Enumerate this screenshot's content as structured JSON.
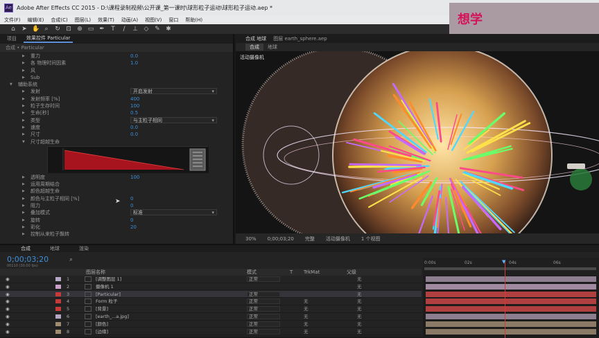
{
  "window": {
    "logo": "Ae",
    "title": "Adobe After Effects CC 2015 - D:\\课程录制视频\\公开课_第一课时\\球形粒子运动\\球形粒子运动.aep *"
  },
  "menu": [
    "文件(F)",
    "编辑(E)",
    "合成(C)",
    "图层(L)",
    "效果(T)",
    "动画(A)",
    "视图(V)",
    "窗口",
    "帮助(H)"
  ],
  "watermark": {
    "text": "想学"
  },
  "effects_panel": {
    "tabs": [
      "项目",
      "效果控件 Particular"
    ],
    "subheader": "合成 • Particular",
    "rows": [
      {
        "indent": 2,
        "label": "重力",
        "value": "0.0"
      },
      {
        "indent": 2,
        "label": "各 物理时间因素",
        "value": "1.0"
      },
      {
        "indent": 2,
        "label": "风",
        "value": ""
      },
      {
        "indent": 2,
        "label": "Sub",
        "value": ""
      },
      {
        "indent": 1,
        "label": "辅助系统",
        "value": "",
        "open": true
      },
      {
        "indent": 2,
        "label": "发射",
        "dropdown": "开启发射"
      },
      {
        "indent": 2,
        "label": "发射频率 [%]",
        "value": "400"
      },
      {
        "indent": 2,
        "label": "粒子生存时间",
        "value": "100"
      },
      {
        "indent": 2,
        "label": "生命[秒]",
        "value": "0.5"
      },
      {
        "indent": 2,
        "label": "类型",
        "dropdown": "与主粒子相同"
      },
      {
        "indent": 2,
        "label": "速度",
        "value": "0.0"
      },
      {
        "indent": 2,
        "label": "尺寸",
        "value": "0.0"
      },
      {
        "indent": 2,
        "label": "尺寸超越生命",
        "value": "",
        "open": true
      }
    ],
    "rows2": [
      {
        "indent": 2,
        "label": "透明度",
        "value": "100"
      },
      {
        "indent": 2,
        "label": "运用周期结合",
        "value": ""
      },
      {
        "indent": 2,
        "label": "颜色超越生命",
        "value": ""
      },
      {
        "indent": 2,
        "label": "颜色与主粒子相同 [%]",
        "value": "0"
      },
      {
        "indent": 2,
        "label": "阻力",
        "value": "0"
      },
      {
        "indent": 2,
        "label": "叠加模式",
        "dropdown": "标准"
      },
      {
        "indent": 2,
        "label": "旋转",
        "value": "0"
      },
      {
        "indent": 2,
        "label": "彩化",
        "value": "20"
      },
      {
        "indent": 2,
        "label": "控制从来粒子飘转",
        "value": ""
      }
    ]
  },
  "viewer": {
    "tabs": [
      "合成 地球",
      "图层 earth_sphere.aep"
    ],
    "subtabs": [
      "合成",
      "地球"
    ],
    "camera_label": "活动摄像机",
    "footer": [
      "30%",
      "0;00;03;20",
      "完整",
      "活动摄像机",
      "1 个视图"
    ]
  },
  "timeline": {
    "tabs": [
      "合成",
      "地球",
      "渲染"
    ],
    "timecode": "0;00;03;20",
    "frames": "00110 (30.00 fps)",
    "header": [
      "图层名称",
      "模式",
      "T",
      "TrkMat",
      "父级"
    ],
    "ruler": [
      "0:00s",
      "02s",
      "04s",
      "06s"
    ],
    "layers": [
      {
        "num": "1",
        "color": "#b4a8c4",
        "name": "[调整图层 1]",
        "mode": "正常",
        "trk": "",
        "parent": "无"
      },
      {
        "num": "2",
        "color": "#c8a0c8",
        "name": "摄像机 1",
        "mode": "",
        "trk": "",
        "parent": "无"
      },
      {
        "num": "3",
        "color": "#c63a3a",
        "name": "[Particular]",
        "mode": "正常",
        "trk": "",
        "parent": "无"
      },
      {
        "num": "4",
        "color": "#c63a3a",
        "name": "Form 粒子",
        "mode": "正常",
        "trk": "无",
        "parent": "无"
      },
      {
        "num": "5",
        "color": "#c63a3a",
        "name": "[背景]",
        "mode": "正常",
        "trk": "无",
        "parent": "无"
      },
      {
        "num": "6",
        "color": "#b4a8c4",
        "name": "[earth_...a.jpg]",
        "mode": "正常",
        "trk": "无",
        "parent": "无"
      },
      {
        "num": "7",
        "color": "#a08c70",
        "name": "[颜色]",
        "mode": "正常",
        "trk": "无",
        "parent": "无"
      },
      {
        "num": "8",
        "color": "#a08c70",
        "name": "[边缘]",
        "mode": "正常",
        "trk": "无",
        "parent": "无"
      }
    ]
  }
}
